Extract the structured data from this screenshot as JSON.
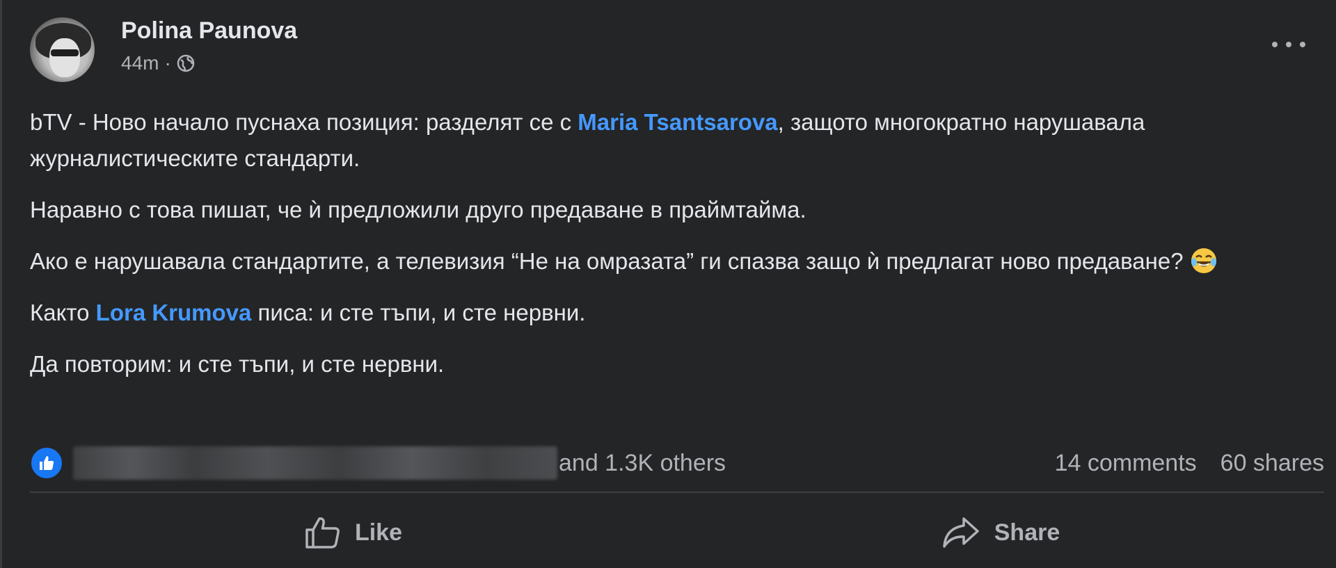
{
  "post": {
    "author": "Polina Paunova",
    "time": "44m",
    "separator": "·",
    "paragraphs": {
      "p1_a": "bTV - Ново начало пуснаха позиция: разделят се с ",
      "p1_mention": "Maria Tsantsarova",
      "p1_b": ", защото многократно нарушавала журналистическите стандарти.",
      "p2": "Наравно с това пишат, че ѝ предложили друго предаване в праймтайма.",
      "p3": "Ако е нарушавала стандартите, а телевизия “Не на омразата” ги спазва защо ѝ предлагат ново предаване?",
      "p4_a": "Както ",
      "p4_mention": "Lora Krumova",
      "p4_b": " писа: и сте тъпи, и сте нервни.",
      "p5": "Да повторим: и сте тъпи, и сте нервни."
    },
    "emoji": "laughing-tears-icon"
  },
  "stats": {
    "reactions_text": "and 1.3K others",
    "comments": "14 comments",
    "shares": "60 shares"
  },
  "actions": {
    "like_label": "Like",
    "share_label": "Share"
  },
  "colors": {
    "background": "#242526",
    "text": "#e4e6eb",
    "secondary": "#b0b3b8",
    "mention": "#4599ff",
    "like_blue": "#1877f2"
  }
}
